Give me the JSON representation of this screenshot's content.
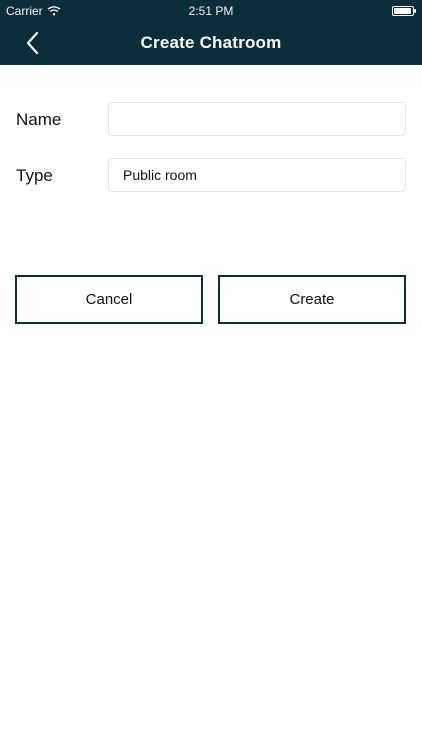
{
  "status_bar": {
    "carrier": "Carrier",
    "time": "2:51 PM",
    "battery_level": 0.95
  },
  "nav": {
    "title": "Create Chatroom",
    "back_icon": "chevron-left-icon"
  },
  "form": {
    "name_label": "Name",
    "name_value": "",
    "type_label": "Type",
    "type_value": "Public room"
  },
  "actions": {
    "cancel_label": "Cancel",
    "create_label": "Create"
  },
  "colors": {
    "header_bg": "#0b2e3a",
    "button_border": "#0b2e3a"
  }
}
